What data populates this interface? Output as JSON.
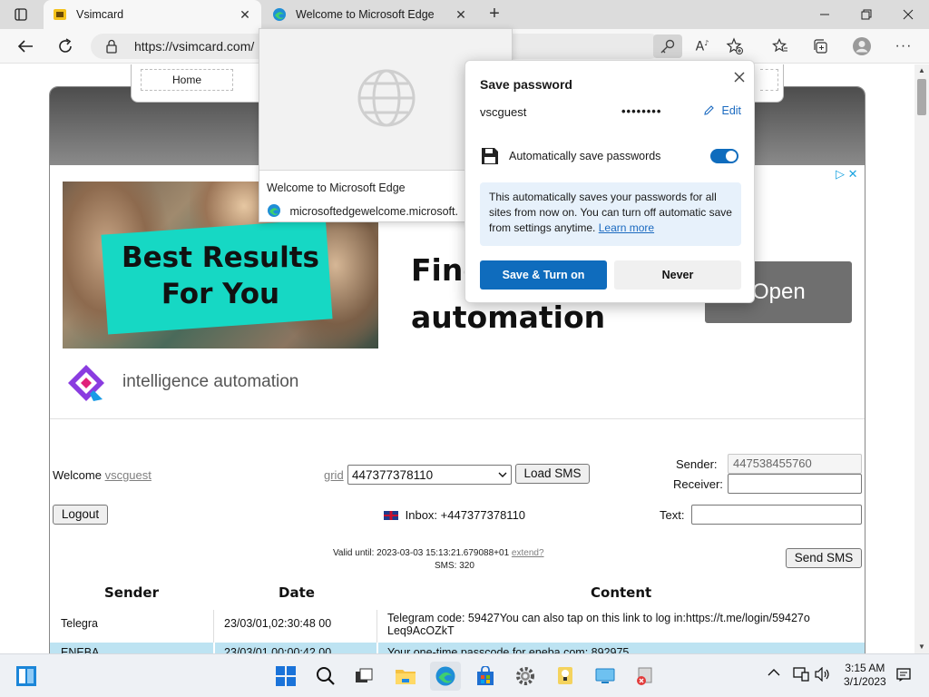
{
  "browser": {
    "tabs": [
      {
        "title": "Vsimcard",
        "active": true
      },
      {
        "title": "Welcome to Microsoft Edge",
        "active": false
      }
    ],
    "address": "https://vsimcard.com/",
    "address_display": "https://vsimcard.com/"
  },
  "page": {
    "nav": {
      "home": "Home"
    },
    "ad": {
      "headline_1": "Best Results",
      "headline_2": "For You",
      "title_1": "Find",
      "title_2": "automation",
      "cta": "Open",
      "brand": "intelligence automation"
    },
    "welcome_label": "Welcome",
    "username": "vscguest",
    "logout": "Logout",
    "grid_link": "grid",
    "selected_number": "447377378110",
    "load_sms": "Load SMS",
    "inbox_label": "Inbox: +447377378110",
    "valid_until": "Valid until: 2023-03-03 15:13:21.679088+01",
    "extend_link": "extend?",
    "sms_count": "SMS: 320",
    "sender_label": "Sender:",
    "sender_value": "447538455760",
    "receiver_label": "Receiver:",
    "receiver_value": "",
    "text_label": "Text:",
    "text_value": "",
    "send_sms": "Send SMS",
    "table": {
      "headers": [
        "Sender",
        "Date",
        "Content"
      ],
      "rows": [
        {
          "sender": "Telegra",
          "date": "23/03/01,02:30:48 00",
          "content_1": "Telegram code: 59427You can also tap on this link to log in:https://t.me/login/59427o",
          "content_2": "Leq9AcOZkT"
        },
        {
          "sender": "ENEBA",
          "date": "23/03/01,00:00:42 00",
          "content_1": "Your one-time passcode for eneba.com: 892975",
          "content_2": ""
        }
      ]
    }
  },
  "preview": {
    "title": "Welcome to Microsoft Edge",
    "url": "microsoftedgewelcome.microsoft."
  },
  "password_popup": {
    "title": "Save password",
    "username": "vscguest",
    "password_mask": "••••••••",
    "edit": "Edit",
    "auto_label": "Automatically save passwords",
    "auto_enabled": true,
    "info_bold": "This automatically saves your passwords for all sites from now on.",
    "info_rest": "You can turn off automatic save from settings anytime.",
    "learn_more": "Learn more",
    "primary": "Save & Turn on",
    "secondary": "Never"
  },
  "taskbar": {
    "time": "3:15 AM",
    "date": "3/1/2023"
  },
  "colors": {
    "accent": "#0f6cbd",
    "ad_teal": "#16d8c4",
    "header_dark": "#4d4d4d",
    "table_highlight": "#bde3f2"
  }
}
